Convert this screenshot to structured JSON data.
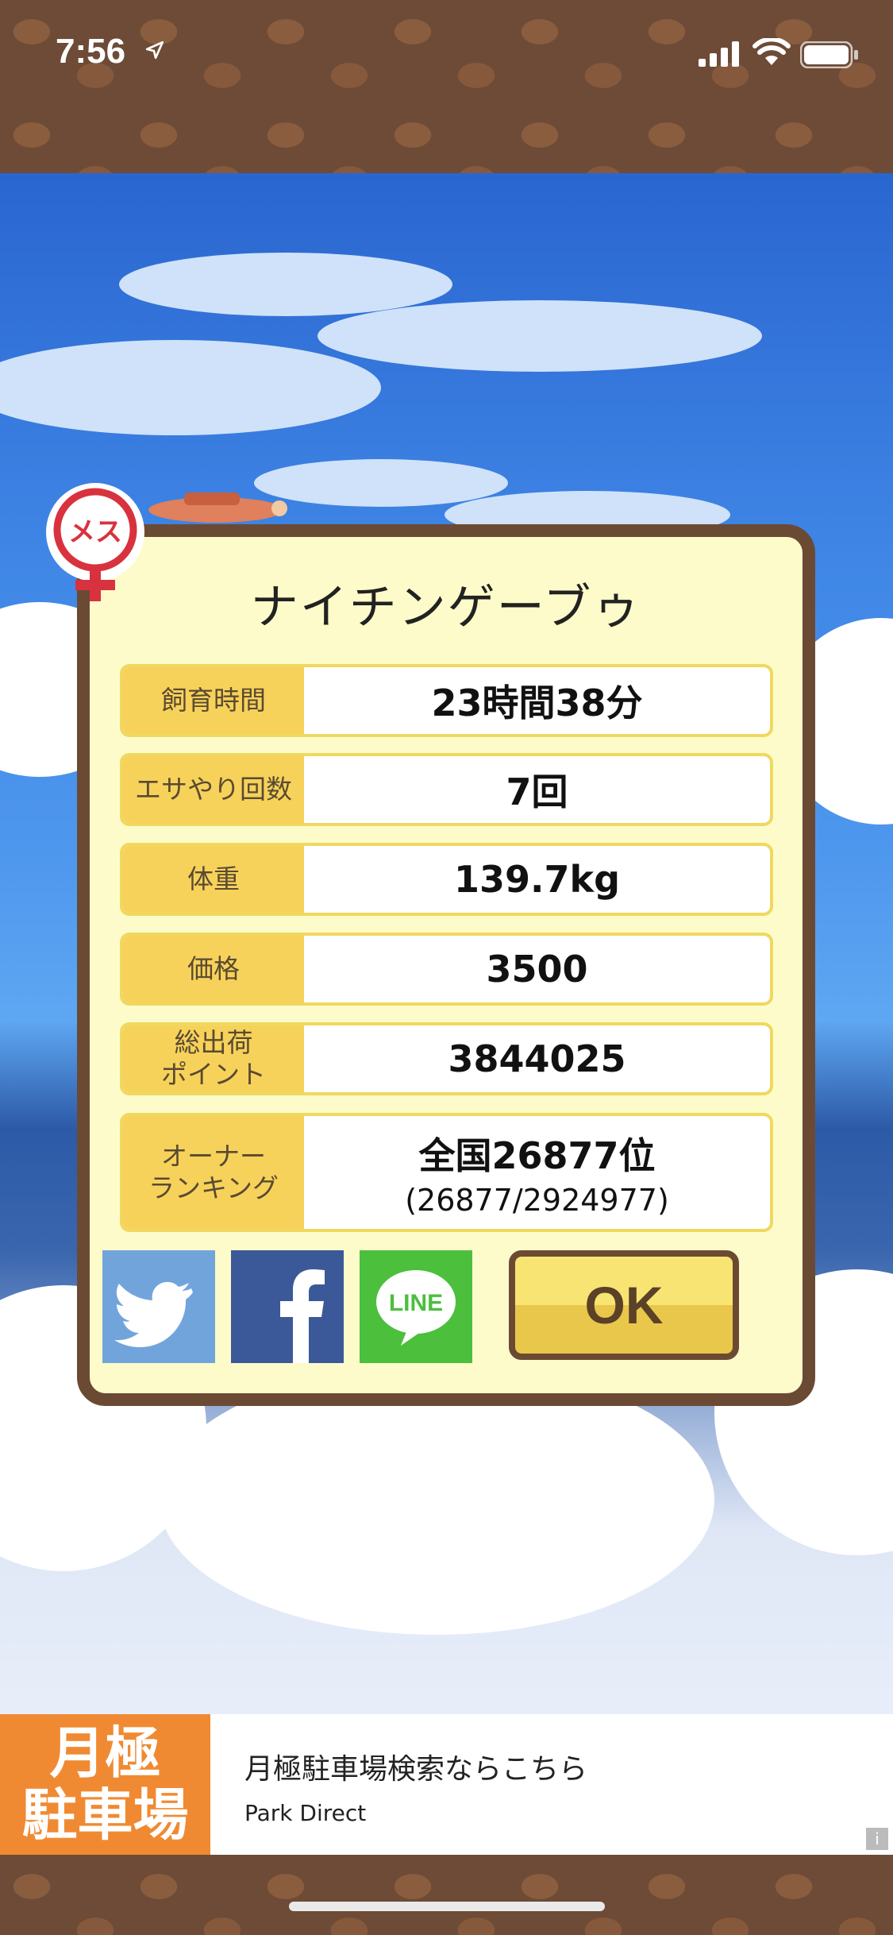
{
  "status_bar": {
    "time": "7:56"
  },
  "dialog": {
    "gender_badge": "メス",
    "title": "ナイチンゲーブゥ",
    "rows": [
      {
        "label": "飼育時間",
        "value": "23時間38分"
      },
      {
        "label": "エサやり回数",
        "value": "7回"
      },
      {
        "label": "体重",
        "value": "139.7kg"
      },
      {
        "label": "価格",
        "value": "3500"
      },
      {
        "label": "総出荷\nポイント",
        "value": "3844025"
      },
      {
        "label": "オーナー\nランキング",
        "value": "全国26877位",
        "sub": "(26877/2924977)"
      }
    ],
    "share": {
      "twitter": "twitter-icon",
      "facebook": "facebook-icon",
      "line": "LINE"
    },
    "ok_label": "OK"
  },
  "ad": {
    "logo_line1": "月極",
    "logo_line2": "駐車場",
    "title": "月極駐車場検索ならこちら",
    "sponsor": "Park Direct",
    "info": "i"
  },
  "colors": {
    "brown": "#6b4a34",
    "panel": "#fdfbc9",
    "label_bg": "#f7d25a",
    "twitter": "#72a4dc",
    "facebook": "#3b5998",
    "line": "#4cbf3d",
    "ad_orange": "#f08a32"
  }
}
